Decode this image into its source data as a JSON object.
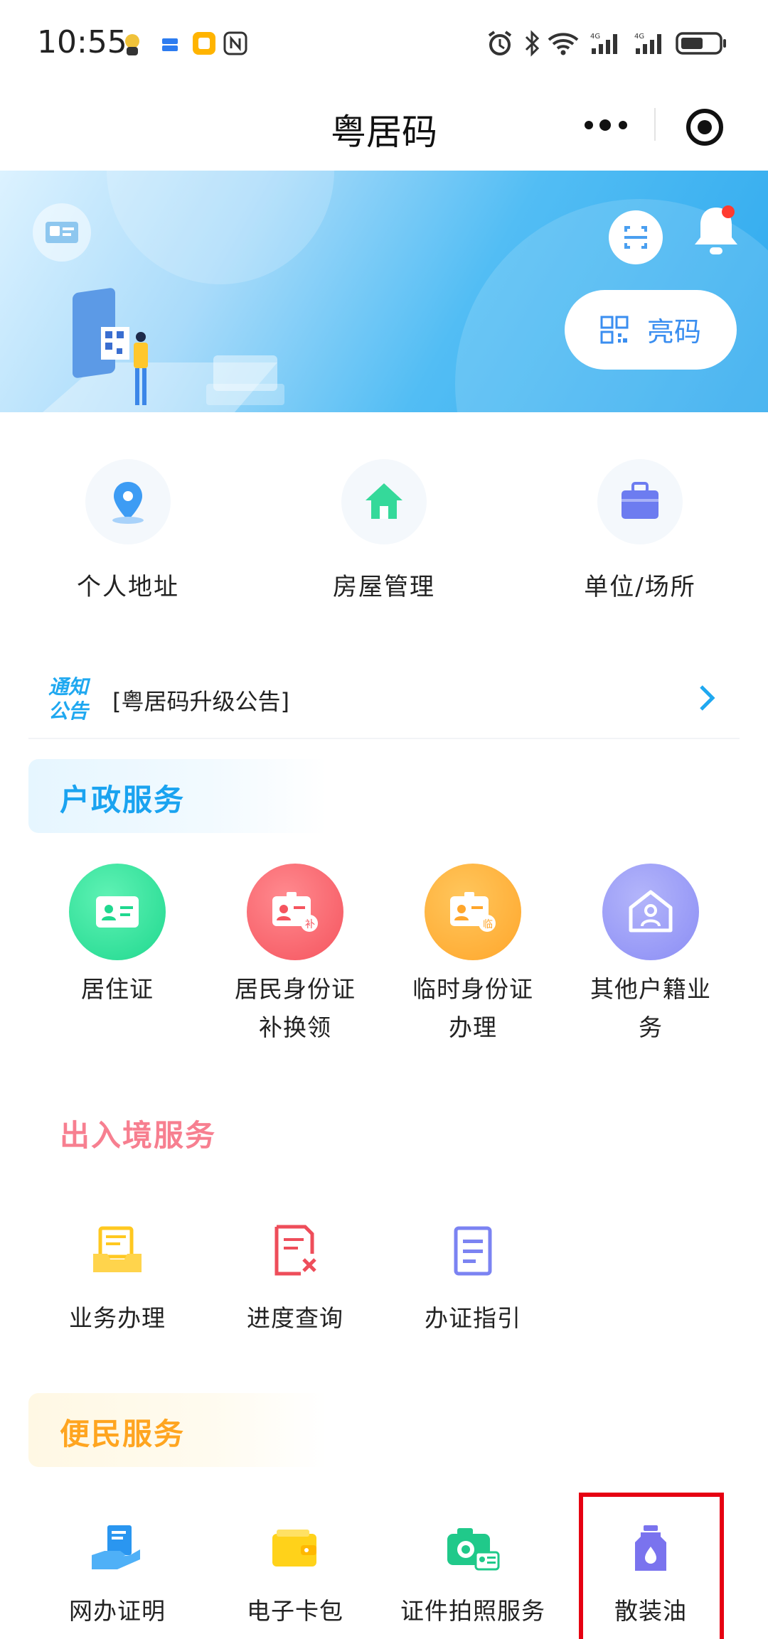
{
  "status_bar": {
    "time": "10:55",
    "icons": [
      "notification-icon",
      "app-icon",
      "app-icon",
      "nfc-icon",
      "alarm-icon",
      "bluetooth-icon",
      "wifi-icon",
      "signal-icon",
      "signal-icon",
      "battery-icon"
    ]
  },
  "nav": {
    "title": "粤居码",
    "more_icon": "more-icon",
    "close_icon": "target-icon"
  },
  "banner": {
    "show_code_label": "亮码",
    "icons": [
      "id-card-icon",
      "scan-icon",
      "bell-icon",
      "qr-icon"
    ],
    "bell_badge_color": "#ff3b30"
  },
  "quick": {
    "items": [
      {
        "label": "个人地址",
        "icon": "location-icon",
        "color": "#3d9cf4"
      },
      {
        "label": "房屋管理",
        "icon": "house-icon",
        "color": "#35d99a"
      },
      {
        "label": "单位/场所",
        "icon": "briefcase-icon",
        "color": "#6d7cf0"
      }
    ]
  },
  "notice": {
    "tag": "通知公告",
    "text": "[粤居码升级公告]"
  },
  "household": {
    "title": "户政服务",
    "title_color": "#1aa3f0",
    "items": [
      {
        "label_line1": "居住证",
        "label_line2": "",
        "icon": "residence-card-icon",
        "color": "#20d88f"
      },
      {
        "label_line1": "居民身份证",
        "label_line2": "补换领",
        "icon": "id-card-replace-icon",
        "color": "#f5545e"
      },
      {
        "label_line1": "临时身份证",
        "label_line2": "办理",
        "icon": "temp-id-card-icon",
        "color": "#ffa62b"
      },
      {
        "label_line1": "其他户籍业",
        "label_line2": "务",
        "icon": "household-icon",
        "color": "#8b8df5"
      }
    ]
  },
  "exit_entry": {
    "title": "出入境服务",
    "title_color": "#f77f90",
    "items": [
      {
        "label": "业务办理",
        "icon": "inbox-icon",
        "color": "#ffc820"
      },
      {
        "label": "进度查询",
        "icon": "document-x-icon",
        "color": "#ee4d5a"
      },
      {
        "label": "办证指引",
        "icon": "document-icon",
        "color": "#7b83f2"
      }
    ]
  },
  "convenience": {
    "title": "便民服务",
    "title_color": "#ffa520",
    "items": [
      {
        "label": "网办证明",
        "icon": "certificate-hand-icon",
        "color": "#2a96f0"
      },
      {
        "label": "电子卡包",
        "icon": "wallet-icon",
        "color": "#ffd21a"
      },
      {
        "label": "证件拍照服务",
        "icon": "camera-icon",
        "color": "#20c98a"
      },
      {
        "label": "散装油",
        "icon": "oil-bottle-icon",
        "color": "#7a73ee"
      }
    ],
    "highlight_color": "#e60012"
  }
}
